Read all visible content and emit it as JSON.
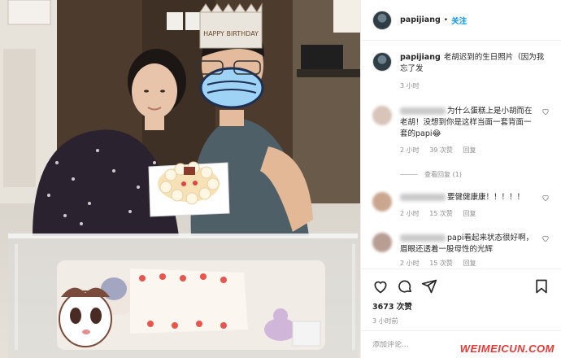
{
  "post": {
    "username": "papijiang",
    "follow_label": "关注",
    "separator": "•",
    "caption": "老胡迟到的生日照片（因为我忘了发",
    "caption_time": "3 小时",
    "likes": "3673 次赞",
    "post_time": "3 小时前",
    "add_comment_placeholder": "添加评论..."
  },
  "comments": [
    {
      "text": "为什么蛋糕上是小胡而在老胡！没想到你是这样当面一套背面一套的papi😂",
      "time": "2 小时",
      "likes": "39 次赞",
      "reply_label": "回复",
      "view_replies": "查看回复 (1)"
    },
    {
      "text": "要健健康康！！！！！",
      "time": "2 小时",
      "likes": "15 次赞",
      "reply_label": "回复"
    },
    {
      "text": "papi看起来状态很好啊，眉眼还透着一股母性的光辉",
      "time": "2 小时",
      "likes": "15 次赞",
      "reply_label": "回复"
    }
  ],
  "photo": {
    "crown_text": "HAPPY BIRTHDAY"
  },
  "watermark": "WEIMEICUN.COM",
  "icons": [
    "heart-icon",
    "comment-icon",
    "share-icon",
    "bookmark-icon"
  ],
  "colors": {
    "link": "#0095f6",
    "muted": "#8e8e8e",
    "watermark": "#e53935"
  }
}
